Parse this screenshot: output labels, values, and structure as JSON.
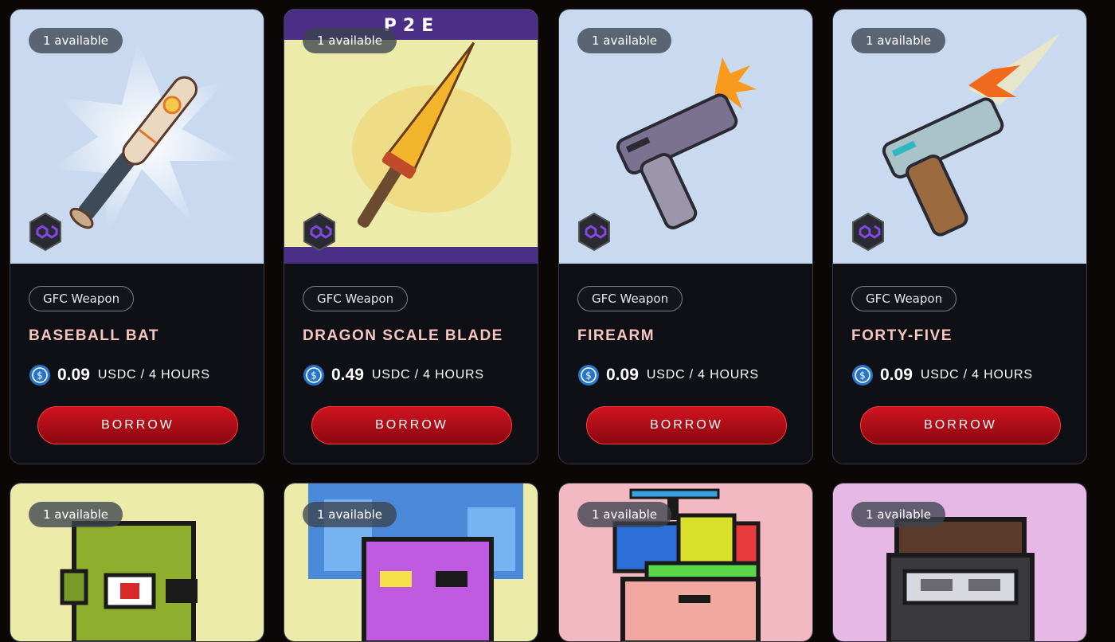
{
  "cards": [
    {
      "available": "1 available",
      "tag": "GFC Weapon",
      "name": "BASEBALL BAT",
      "amount": "0.09",
      "unit": "USDC / 4 HOURS",
      "button": "BORROW",
      "bg": "#c9d9ef",
      "icon": "baseball-bat-icon"
    },
    {
      "available": "1 available",
      "tag": "GFC Weapon",
      "name": "DRAGON SCALE BLADE",
      "amount": "0.49",
      "unit": "USDC / 4 HOURS",
      "button": "BORROW",
      "bg": "#ecebaa",
      "banner": "P2E",
      "icon": "dragon-blade-icon"
    },
    {
      "available": "1 available",
      "tag": "GFC Weapon",
      "name": "FIREARM",
      "amount": "0.09",
      "unit": "USDC / 4 HOURS",
      "button": "BORROW",
      "bg": "#c9d9ef",
      "icon": "pistol-icon"
    },
    {
      "available": "1 available",
      "tag": "GFC Weapon",
      "name": "FORTY-FIVE",
      "amount": "0.09",
      "unit": "USDC / 4 HOURS",
      "button": "BORROW",
      "bg": "#c9d9ef",
      "icon": "pistol-icon"
    },
    {
      "available": "1 available",
      "bg": "#ecebaa",
      "icon": "pixel-orc-icon"
    },
    {
      "available": "1 available",
      "bg": "#ecebaa",
      "icon": "pixel-punk-icon"
    },
    {
      "available": "1 available",
      "bg": "#f2b9c3",
      "icon": "pixel-propeller-hat-icon"
    },
    {
      "available": "1 available",
      "bg": "#e6b8e6",
      "icon": "pixel-visor-icon"
    }
  ],
  "colors": {
    "accent": "#d0141f",
    "name": "#f6c6bf",
    "polygon": "#8247e5",
    "usdc": "#2775ca"
  }
}
